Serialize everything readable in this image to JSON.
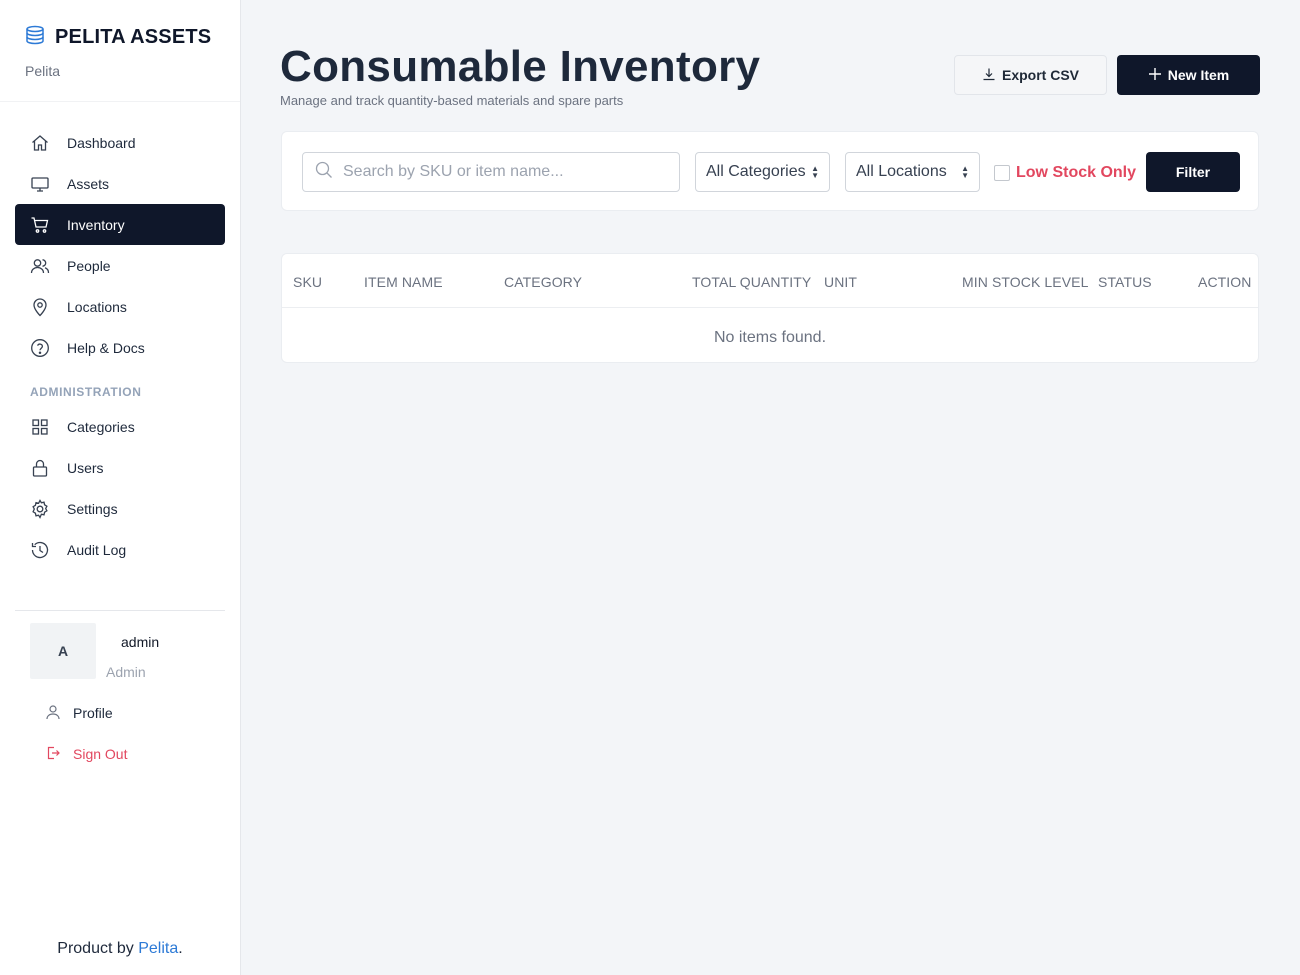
{
  "brand": {
    "name": "PELITA ASSETS",
    "subtitle": "Pelita"
  },
  "nav": {
    "items": [
      {
        "label": "Dashboard",
        "icon": "home-icon"
      },
      {
        "label": "Assets",
        "icon": "monitor-icon"
      },
      {
        "label": "Inventory",
        "icon": "cart-icon",
        "active": true
      },
      {
        "label": "People",
        "icon": "users-icon"
      },
      {
        "label": "Locations",
        "icon": "map-pin-icon"
      },
      {
        "label": "Help & Docs",
        "icon": "help-icon"
      }
    ],
    "section_label": "ADMINISTRATION",
    "admin_items": [
      {
        "label": "Categories",
        "icon": "grid-icon"
      },
      {
        "label": "Users",
        "icon": "lock-icon"
      },
      {
        "label": "Settings",
        "icon": "gear-icon"
      },
      {
        "label": "Audit Log",
        "icon": "history-icon"
      }
    ]
  },
  "user": {
    "initial": "A",
    "name": "admin",
    "role": "Admin",
    "profile_label": "Profile",
    "signout_label": "Sign Out"
  },
  "footer": {
    "prefix": "Product by ",
    "link": "Pelita",
    "suffix": "."
  },
  "page": {
    "title": "Consumable Inventory",
    "subtitle": "Manage and track quantity-based materials and spare parts",
    "export_label": "Export CSV",
    "new_label": "New Item"
  },
  "filters": {
    "search_placeholder": "Search by SKU or item name...",
    "category": "All Categories",
    "location": "All Locations",
    "low_stock_label": "Low Stock Only",
    "filter_label": "Filter"
  },
  "table": {
    "headers": [
      "SKU",
      "ITEM NAME",
      "CATEGORY",
      "TOTAL QUANTITY",
      "UNIT",
      "MIN STOCK LEVEL",
      "STATUS",
      "ACTION"
    ],
    "empty_text": "No items found."
  },
  "colors": {
    "primary": "#0f172a",
    "danger": "#e2475f",
    "link": "#2d7ad6",
    "background": "#f3f5f8"
  }
}
